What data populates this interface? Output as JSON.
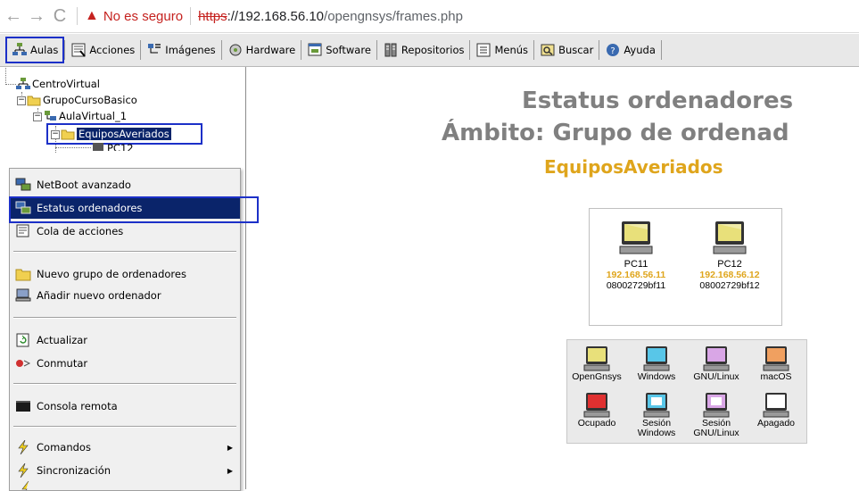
{
  "browser": {
    "security_label": "No es seguro",
    "url_scheme": "https",
    "url_rest": "://192.168.56.10",
    "url_path": "/opengnsys/frames.php"
  },
  "menubar": {
    "items": [
      "Aulas",
      "Acciones",
      "Imágenes",
      "Hardware",
      "Software",
      "Repositorios",
      "Menús",
      "Buscar",
      "Ayuda"
    ]
  },
  "tree": {
    "root": "CentroVirtual",
    "group": "GrupoCursoBasico",
    "classroom": "AulaVirtual_1",
    "selected_group": "EquiposAveriados",
    "partial_child": "PC12"
  },
  "context_menu": {
    "items": [
      "NetBoot avanzado",
      "Estatus ordenadores",
      "Cola de acciones",
      "Nuevo grupo de ordenadores",
      "Añadir nuevo ordenador",
      "Actualizar",
      "Conmutar",
      "Consola remota",
      "Comandos",
      "Sincronización"
    ]
  },
  "content": {
    "title": "Estatus ordenadores",
    "scope": "Ámbito: Grupo de ordenad",
    "group_name": "EquiposAveriados",
    "computers": [
      {
        "name": "PC11",
        "ip": "192.168.56.11",
        "mac": "08002729bf11",
        "status_color": "#e8e07a"
      },
      {
        "name": "PC12",
        "ip": "192.168.56.12",
        "mac": "08002729bf12",
        "status_color": "#e8e07a"
      }
    ],
    "legend": [
      {
        "label": "OpenGnsys",
        "color": "#e8e07a"
      },
      {
        "label": "Windows",
        "color": "#58c6e8"
      },
      {
        "label": "GNU/Linux",
        "color": "#d9a6e6"
      },
      {
        "label": "macOS",
        "color": "#f0a060"
      },
      {
        "label": "Ocupado",
        "color": "#e03030"
      },
      {
        "label": "Sesión Windows",
        "color": "#58c6e8"
      },
      {
        "label": "Sesión GNU/Linux",
        "color": "#d9a6e6"
      },
      {
        "label": "Apagado",
        "color": "#ffffff"
      }
    ]
  },
  "colors": {
    "highlight": "#1c30c8",
    "selection_bg": "#0a246a",
    "title_gray": "#808080",
    "accent_gold": "#dfa51c"
  }
}
